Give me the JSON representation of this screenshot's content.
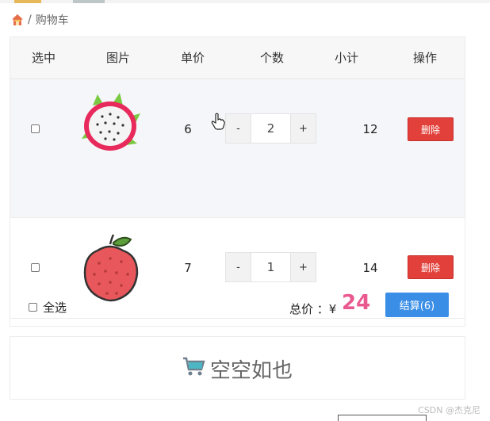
{
  "breadcrumb": {
    "separator": "/",
    "label": "购物车"
  },
  "table": {
    "headers": [
      "选中",
      "图片",
      "单价",
      "个数",
      "小计",
      "操作"
    ],
    "rows": [
      {
        "name": "dragon-fruit",
        "price": "6",
        "qty": "2",
        "subtotal": "12",
        "delete_label": "删除",
        "minus": "-",
        "plus": "+"
      },
      {
        "name": "lychee",
        "price": "7",
        "qty": "1",
        "subtotal": "14",
        "delete_label": "删除",
        "minus": "-",
        "plus": "+"
      }
    ]
  },
  "footer": {
    "select_all_label": "全选",
    "total_label": "总价 ：¥",
    "total_value": "24",
    "checkout_label": "结算(6)"
  },
  "empty": {
    "text": "空空如也",
    "icon": "cart-icon"
  },
  "watermark": "CSDN @杰克尼",
  "colors": {
    "delete": "#e2403a",
    "checkout": "#3a8ee6",
    "total": "#e9598f",
    "header_bg": "#f7f7f8"
  }
}
